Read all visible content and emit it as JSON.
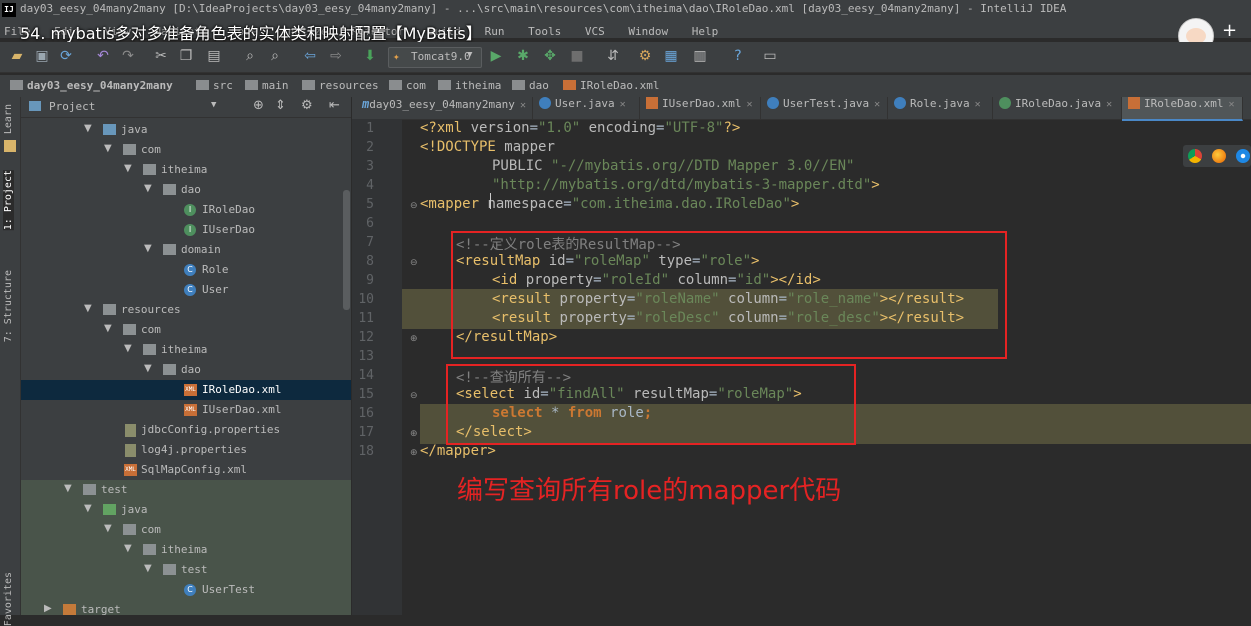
{
  "window": {
    "title": "day03_eesy_04many2many [D:\\IdeaProjects\\day03_eesy_04many2many] - ...\\src\\main\\resources\\com\\itheima\\dao\\IRoleDao.xml [day03_eesy_04many2many] - IntelliJ IDEA",
    "app_icon": "IJ"
  },
  "menu": {
    "items": [
      "File",
      "Edit",
      "View",
      "Navigate",
      "Code",
      "Analyze",
      "Refactor",
      "Build",
      "Run",
      "Tools",
      "VCS",
      "Window",
      "Help"
    ]
  },
  "video_overlay": {
    "title": "54. mybatis多对多准备角色表的实体类和映射配置【MyBatis】",
    "follow_label": "+ 关"
  },
  "toolbar": {
    "run_config": "Tomcat9.0"
  },
  "breadcrumb": [
    "day03_eesy_04many2many",
    "src",
    "main",
    "resources",
    "com",
    "itheima",
    "dao",
    "IRoleDao.xml"
  ],
  "left_stripe": {
    "tabs": [
      "1: Project",
      "7: Structure",
      "Learn",
      "Favorites"
    ]
  },
  "project_panel": {
    "header": "Project",
    "tree": [
      {
        "label": "java",
        "icon": "folder-blue"
      },
      {
        "label": "com",
        "icon": "folder"
      },
      {
        "label": "itheima",
        "icon": "folder"
      },
      {
        "label": "dao",
        "icon": "folder"
      },
      {
        "label": "IRoleDao",
        "icon": "interface"
      },
      {
        "label": "IUserDao",
        "icon": "interface"
      },
      {
        "label": "domain",
        "icon": "folder"
      },
      {
        "label": "Role",
        "icon": "class"
      },
      {
        "label": "User",
        "icon": "class"
      },
      {
        "label": "resources",
        "icon": "folder-gray"
      },
      {
        "label": "com",
        "icon": "folder"
      },
      {
        "label": "itheima",
        "icon": "folder"
      },
      {
        "label": "dao",
        "icon": "folder"
      },
      {
        "label": "IRoleDao.xml",
        "icon": "xml",
        "selected": true
      },
      {
        "label": "IUserDao.xml",
        "icon": "xml"
      },
      {
        "label": "jdbcConfig.properties",
        "icon": "properties"
      },
      {
        "label": "log4j.properties",
        "icon": "properties"
      },
      {
        "label": "SqlMapConfig.xml",
        "icon": "xml"
      },
      {
        "label": "test",
        "icon": "folder"
      },
      {
        "label": "java",
        "icon": "folder-green"
      },
      {
        "label": "com",
        "icon": "folder"
      },
      {
        "label": "itheima",
        "icon": "folder"
      },
      {
        "label": "test",
        "icon": "folder"
      },
      {
        "label": "UserTest",
        "icon": "class"
      },
      {
        "label": "target",
        "icon": "folder-orange"
      }
    ]
  },
  "editor_tabs": [
    {
      "label": "day03_eesy_04many2many",
      "icon": "m"
    },
    {
      "label": "User.java",
      "icon": "class"
    },
    {
      "label": "IUserDao.xml",
      "icon": "xml"
    },
    {
      "label": "UserTest.java",
      "icon": "class"
    },
    {
      "label": "Role.java",
      "icon": "class"
    },
    {
      "label": "IRoleDao.java",
      "icon": "interface"
    },
    {
      "label": "IRoleDao.xml",
      "icon": "xml",
      "active": true
    }
  ],
  "code": {
    "line_numbers": [
      "1",
      "2",
      "3",
      "4",
      "5",
      "6",
      "7",
      "8",
      "9",
      "10",
      "11",
      "12",
      "13",
      "14",
      "15",
      "16",
      "17",
      "18"
    ],
    "l1_a": "<?xml ",
    "l1_b": "version",
    "l1_c": "=",
    "l1_d": "\"1.0\"",
    "l1_e": " encoding",
    "l1_f": "=",
    "l1_g": "\"UTF-8\"",
    "l1_h": "?>",
    "l2_a": "<!DOCTYPE ",
    "l2_b": "mapper",
    "l3_a": "PUBLIC ",
    "l3_b": "\"-//mybatis.org//DTD Mapper 3.0//EN\"",
    "l4_a": "\"http://mybatis.org/dtd/mybatis-3-mapper.dtd\"",
    "l4_b": ">",
    "l5_a": "<mapper ",
    "l5_b": "namespace",
    "l5_c": "=",
    "l5_d": "\"com.itheima.dao.IRoleDao\"",
    "l5_e": ">",
    "l7": "<!--定义role表的ResultMap-->",
    "l8_a": "<resultMap ",
    "l8_b": "id",
    "l8_c": "=",
    "l8_d": "\"roleMap\"",
    "l8_e": " type",
    "l8_f": "=",
    "l8_g": "\"role\"",
    "l8_h": ">",
    "l9_a": "<id ",
    "l9_b": "property",
    "l9_c": "=",
    "l9_d": "\"roleId\"",
    "l9_e": " column",
    "l9_f": "=",
    "l9_g": "\"id\"",
    "l9_h": "></id>",
    "l10_a": "<result ",
    "l10_b": "property",
    "l10_c": "=",
    "l10_d": "\"roleName\"",
    "l10_e": " column",
    "l10_f": "=",
    "l10_g": "\"role_name\"",
    "l10_h": "></result>",
    "l11_a": "<result ",
    "l11_b": "property",
    "l11_c": "=",
    "l11_d": "\"roleDesc\"",
    "l11_e": " column",
    "l11_f": "=",
    "l11_g": "\"role_desc\"",
    "l11_h": "></result>",
    "l12": "</resultMap>",
    "l14": "<!--查询所有-->",
    "l15_a": "<select ",
    "l15_b": "id",
    "l15_c": "=",
    "l15_d": "\"findAll\"",
    "l15_e": " resultMap",
    "l15_f": "=",
    "l15_g": "\"roleMap\"",
    "l15_h": ">",
    "l16_a": "select ",
    "l16_b": "* ",
    "l16_c": "from ",
    "l16_d": "role",
    "l16_e": ";",
    "l17": "</select>",
    "l18": "</mapper>"
  },
  "annotation": "编写查询所有role的mapper代码",
  "colors": {
    "annotation_red": "#e52323",
    "editor_bg": "#2b2b2b",
    "tag": "#e8bf6a",
    "string": "#6a8759",
    "comment": "#808080",
    "keyword": "#cc7832"
  }
}
